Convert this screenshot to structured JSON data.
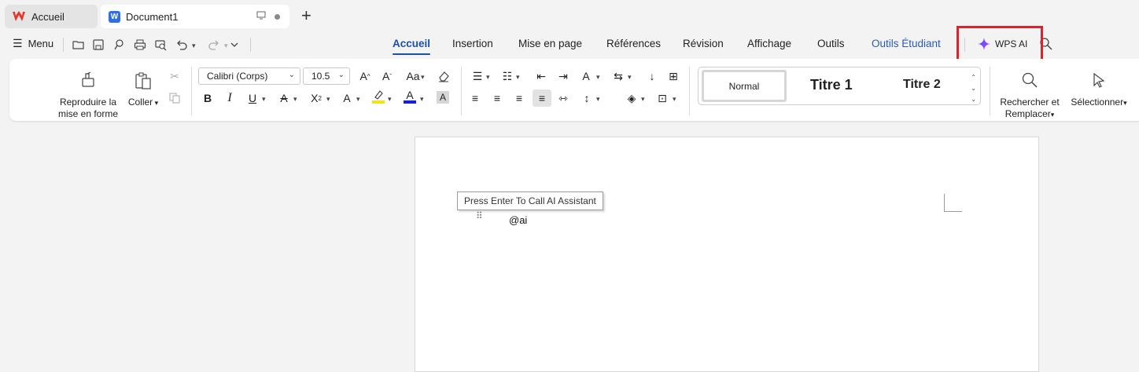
{
  "tabs": {
    "home_label": "Accueil",
    "doc_label": "Document1"
  },
  "menu": {
    "label": "Menu"
  },
  "ribbon_tabs": [
    {
      "label": "Accueil"
    },
    {
      "label": "Insertion"
    },
    {
      "label": "Mise en page"
    },
    {
      "label": "Références"
    },
    {
      "label": "Révision"
    },
    {
      "label": "Affichage"
    },
    {
      "label": "Outils"
    },
    {
      "label": "Outils Étudiant"
    }
  ],
  "wps_ai": {
    "label": "WPS AI"
  },
  "ribbon": {
    "format_painter": [
      "Reproduire la",
      "mise en forme"
    ],
    "paste": "Coller",
    "font_name": "Calibri (Corps)",
    "font_size": "10.5",
    "styles": {
      "normal": "Normal",
      "title1": "Titre 1",
      "title2": "Titre 2"
    },
    "find_replace": [
      "Rechercher et",
      "Remplacer"
    ],
    "select": "Sélectionner"
  },
  "document": {
    "tooltip": "Press Enter To Call AI Assistant",
    "text": "@ai"
  },
  "colors": {
    "accent": "#1f4fa8",
    "highlight_box": "#e0202a",
    "wps_red": "#e8352b",
    "word_blue": "#2f6fe6"
  },
  "icons": [
    "wps-logo-icon",
    "writer-logo-icon",
    "monitor-icon",
    "plus-icon",
    "hamburger-icon",
    "open-folder-icon",
    "save-icon",
    "export-pdf-icon",
    "print-icon",
    "print-preview-icon",
    "undo-icon",
    "redo-icon",
    "more-icon",
    "sparkle-icon",
    "search-icon"
  ]
}
